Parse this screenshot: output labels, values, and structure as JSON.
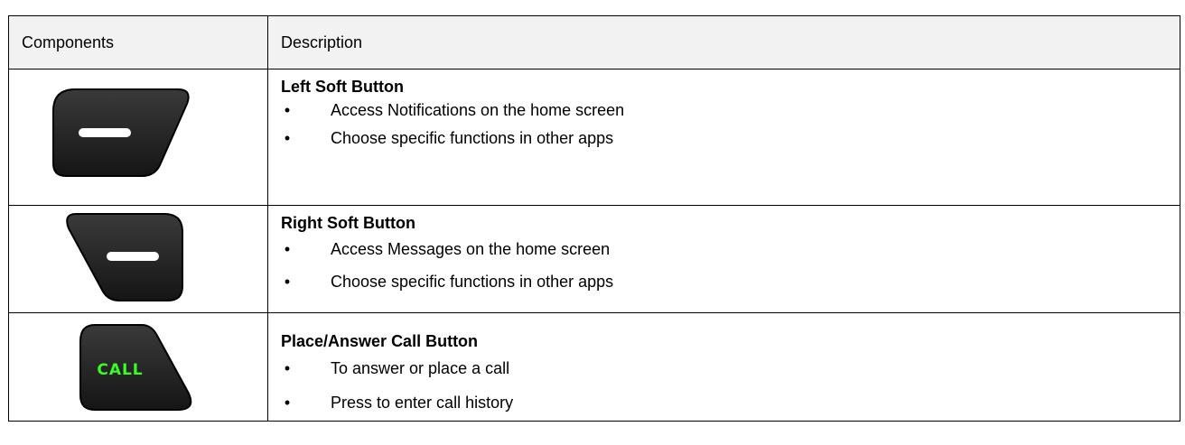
{
  "table": {
    "header": {
      "components": "Components",
      "description": "Description"
    },
    "rows": [
      {
        "title": "Left Soft Button",
        "bullet_symbol": "•",
        "bullets": [
          "Access Notifications on the home screen",
          "Choose specific functions in other apps"
        ],
        "icon": "left-soft-button-icon"
      },
      {
        "title": "Right Soft Button",
        "bullet_symbol": "•",
        "bullets": [
          "Access Messages on the home screen",
          "Choose specific functions in other apps"
        ],
        "icon": "right-soft-button-icon"
      },
      {
        "title": "Place/Answer Call Button",
        "bullet_symbol": "•",
        "bullets": [
          "To answer or place a call",
          "Press to enter call history"
        ],
        "icon": "call-button-icon",
        "icon_label": "CALL"
      }
    ]
  },
  "colors": {
    "button_body": "#1f1f1f",
    "button_bar": "#ffffff",
    "call_text": "#3cff2a",
    "header_bg": "#f2f2f2",
    "border": "#000000"
  }
}
